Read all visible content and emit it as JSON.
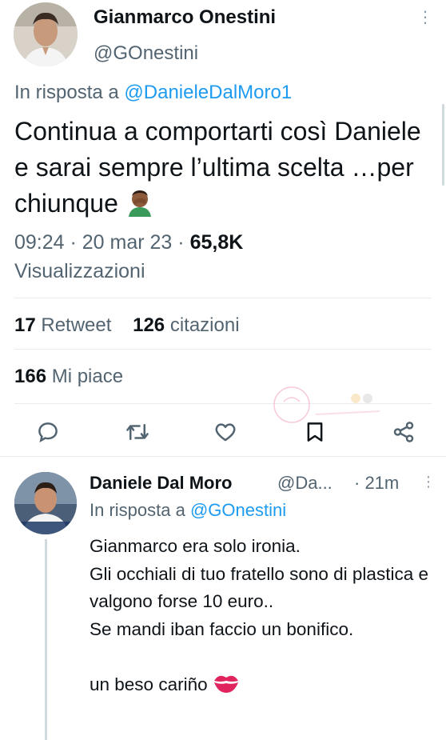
{
  "main_tweet": {
    "author_name": "Gianmarco Onestini",
    "author_handle": "@GOnestini",
    "reply_prefix": "In risposta a",
    "reply_mention": "@DanieleDalMoro1",
    "text": "Continua a comportarti così Daniele e sarai sempre l’ultima scelta …per chiunque",
    "emoji": "man-facepalming-icon",
    "time_date": "09:24 · 20 mar 23 · ",
    "views_count": "65,8K",
    "views_label": "Visualizzazioni",
    "retweets_count": "17",
    "retweets_label": "Retweet",
    "quotes_count": "126",
    "quotes_label": "citazioni",
    "likes_count": "166",
    "likes_label": "Mi piace"
  },
  "actions": [
    "reply-icon",
    "retweet-icon",
    "like-icon",
    "bookmark-icon",
    "share-icon"
  ],
  "reply_tweet": {
    "author_name": "Daniele Dal Moro",
    "author_handle": "@Da...",
    "time_ago": "· 21m",
    "reply_prefix": "In risposta a",
    "reply_mention": "@GOnestini",
    "text": "Gianmarco era solo ironia.\nGli occhiali di tuo fratello sono di plastica e valgono forse 10 euro..\nSe mandi iban faccio  un bonifico.\n\nun beso cariño",
    "emoji": "kiss-mark-icon"
  },
  "colors": {
    "text": "#0f1419",
    "secondary": "#536471",
    "link": "#1d9bf0",
    "divider": "#e6ecf0",
    "icon": "#536471"
  }
}
